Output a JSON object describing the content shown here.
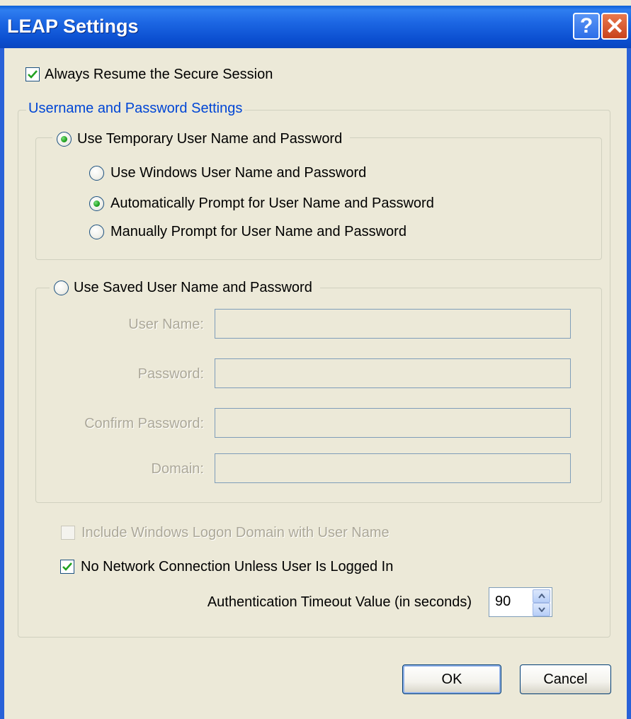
{
  "window": {
    "title": "LEAP Settings",
    "help_glyph": "?",
    "close_glyph": "✕"
  },
  "always_resume": {
    "label": "Always Resume the Secure Session",
    "checked": true
  },
  "credentials_group": {
    "legend": "Username and Password Settings",
    "temporary": {
      "label": "Use Temporary User Name and Password",
      "selected": true,
      "options": [
        {
          "label": "Use Windows User Name and Password",
          "selected": false
        },
        {
          "label": "Automatically Prompt for User Name and Password",
          "selected": true
        },
        {
          "label": "Manually Prompt for User Name and Password",
          "selected": false
        }
      ]
    },
    "saved": {
      "label": "Use Saved User Name and Password",
      "selected": false,
      "fields": [
        {
          "label": "User Name:",
          "value": ""
        },
        {
          "label": "Password:",
          "value": ""
        },
        {
          "label": "Confirm Password:",
          "value": ""
        },
        {
          "label": "Domain:",
          "value": ""
        }
      ]
    },
    "include_domain": {
      "label": "Include Windows Logon Domain with User Name",
      "checked": false,
      "enabled": false
    },
    "no_network": {
      "label": "No Network Connection Unless User Is Logged In",
      "checked": true
    },
    "timeout": {
      "label": "Authentication Timeout Value (in seconds)",
      "value": "90"
    }
  },
  "buttons": {
    "ok": "OK",
    "cancel": "Cancel"
  },
  "colors": {
    "title_bar": "#0a5fd8",
    "face": "#ece9d8",
    "legend_text": "#0046d5",
    "check_mark": "#21a121"
  }
}
